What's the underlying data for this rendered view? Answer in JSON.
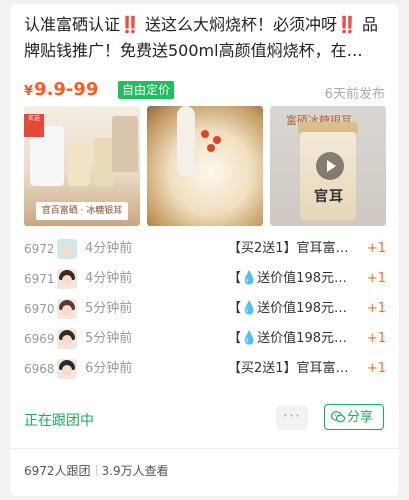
{
  "post": {
    "title": "认准富硒认证‼️ 送这么大焖烧杯！必须冲呀‼️ 品牌贴钱推广！免费送500ml高颜值焖烧杯，在…",
    "price_symbol": "¥",
    "price": "9.9-99",
    "price_badge": "自由定价",
    "posted_time": "6天前发布"
  },
  "images": {
    "img1_caption": "官百富硒 · 冰糖银耳",
    "img1_stamp": "买送",
    "img3_caption": "富硒冰糖银耳",
    "img3_jar_label": "官耳"
  },
  "orders": [
    {
      "num": "6972",
      "time": "4分钟前",
      "text": "【买2送1】官耳富…",
      "qty": "+1"
    },
    {
      "num": "6971",
      "time": "4分钟前",
      "text": "【💧送价值198元…",
      "qty": "+1"
    },
    {
      "num": "6970",
      "time": "5分钟前",
      "text": "【💧送价值198元…",
      "qty": "+1"
    },
    {
      "num": "6969",
      "time": "5分钟前",
      "text": "【💧送价值198元…",
      "qty": "+1"
    },
    {
      "num": "6968",
      "time": "6分钟前",
      "text": "【买2送1】官耳富…",
      "qty": "+1"
    }
  ],
  "actions": {
    "follow_status": "正在跟团中",
    "more": "···",
    "share_label": "分享",
    "share_icon": "wechat-icon"
  },
  "stats": {
    "joined": "6972人跟团",
    "views": "3.9万人查看"
  },
  "colors": {
    "accent_green": "#1aad5a",
    "price_orange": "#ff5a1f",
    "badge_green": "#1fbf5f"
  }
}
